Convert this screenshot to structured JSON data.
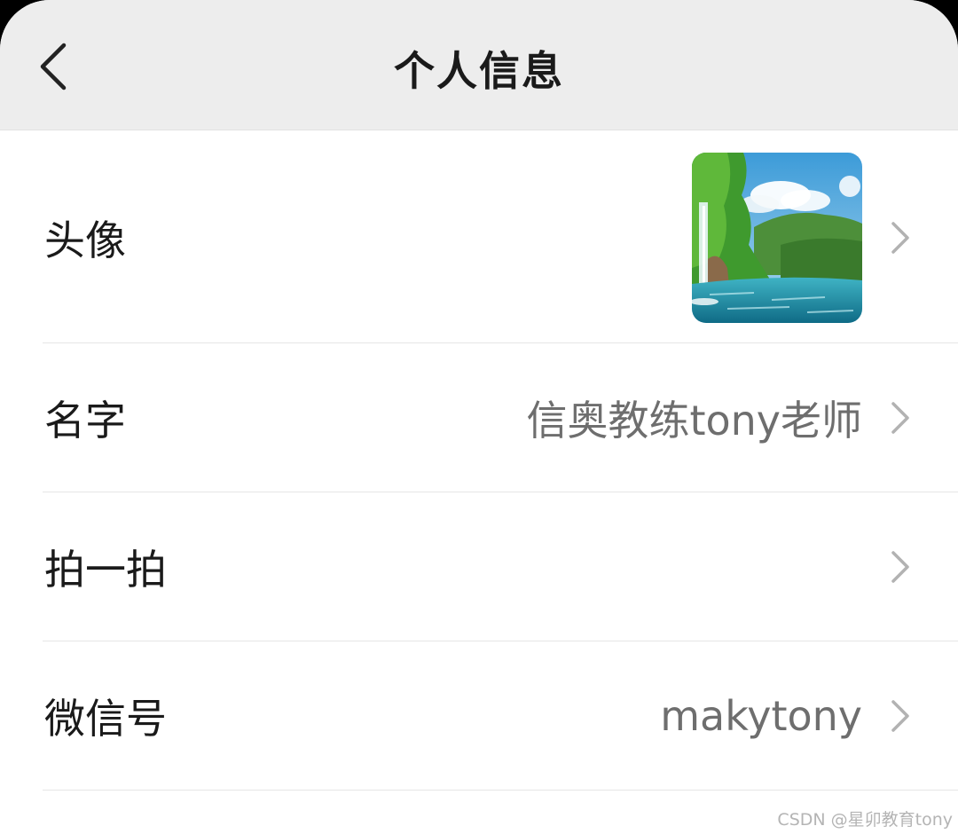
{
  "header": {
    "title": "个人信息"
  },
  "rows": [
    {
      "label": "头像"
    },
    {
      "label": "名字",
      "value": "信奥教练tony老师"
    },
    {
      "label": "拍一拍"
    },
    {
      "label": "微信号",
      "value": "makytony"
    }
  ],
  "watermark": "CSDN @星卯教育tony",
  "colors": {
    "header_bg": "#ededed",
    "label": "#1a1a1a",
    "value": "#6e6e6e",
    "chevron": "#b2b2b2",
    "divider": "#e6e6e6"
  }
}
